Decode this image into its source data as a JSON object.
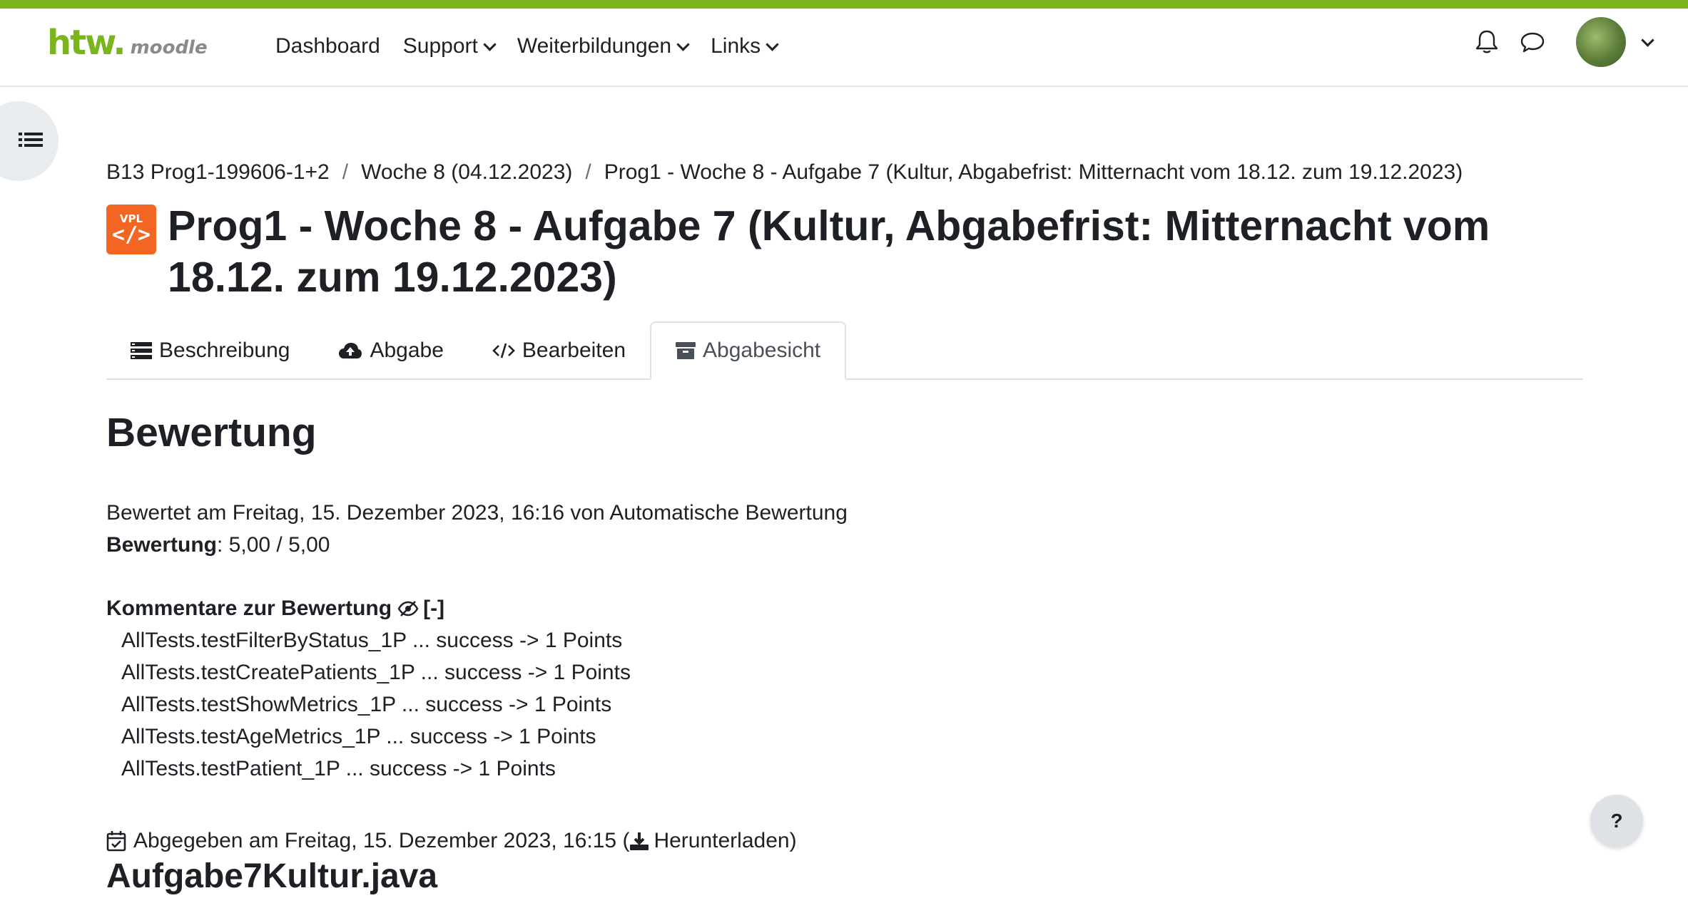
{
  "brand": {
    "logo_main": "htw.",
    "logo_sub": "moodle",
    "accent_color": "#7ab51d"
  },
  "nav": {
    "items": [
      {
        "label": "Dashboard"
      },
      {
        "label": "Support"
      },
      {
        "label": "Weiterbildungen"
      },
      {
        "label": "Links"
      }
    ],
    "icons": [
      "bell-icon",
      "chat-bubble-icon",
      "avatar",
      "chevron-down-icon"
    ]
  },
  "breadcrumb": {
    "items": [
      {
        "label": "B13 Prog1-199606-1+2"
      },
      {
        "label": "Woche 8 (04.12.2023)"
      },
      {
        "label": "Prog1 - Woche 8 - Aufgabe 7 (Kultur, Abgabefrist: Mitternacht vom 18.12. zum 19.12.2023)"
      }
    ],
    "separator": "/"
  },
  "activity": {
    "icon_label": "VPL",
    "icon_glyph": "</>",
    "icon_color": "#f26522",
    "title_line1": "Prog1 - Woche 8 - Aufgabe 7 (Kultur, Abgabefrist: Mitternacht vom",
    "title_line2": "18.12. zum 19.12.2023)"
  },
  "tabs": [
    {
      "label": "Beschreibung",
      "icon": "list-icon",
      "active": false
    },
    {
      "label": "Abgabe",
      "icon": "cloud-upload-icon",
      "active": false
    },
    {
      "label": "Bearbeiten",
      "icon": "code-icon",
      "active": false
    },
    {
      "label": "Abgabesicht",
      "icon": "archive-icon",
      "active": true
    }
  ],
  "grading": {
    "heading": "Bewertung",
    "graded_on": "Bewertet am Freitag, 15. Dezember 2023, 16:16 von Automatische Bewertung",
    "grade_label": "Bewertung",
    "grade_value": ": 5,00 / 5,00",
    "comments_label": "Kommentare zur Bewertung",
    "comments_toggle": "[-]",
    "comments": [
      "AllTests.testFilterByStatus_1P ... success -> 1 Points",
      "AllTests.testCreatePatients_1P ... success -> 1 Points",
      "AllTests.testShowMetrics_1P ... success -> 1 Points",
      "AllTests.testAgeMetrics_1P ... success -> 1 Points",
      "AllTests.testPatient_1P ... success -> 1 Points"
    ]
  },
  "submission": {
    "submitted_text": "Abgegeben am Freitag, 15. Dezember 2023, 16:15 (",
    "download_label": "Herunterladen",
    "closing": ")",
    "file_heading": "Aufgabe7Kultur.java"
  },
  "help": {
    "label": "?"
  }
}
